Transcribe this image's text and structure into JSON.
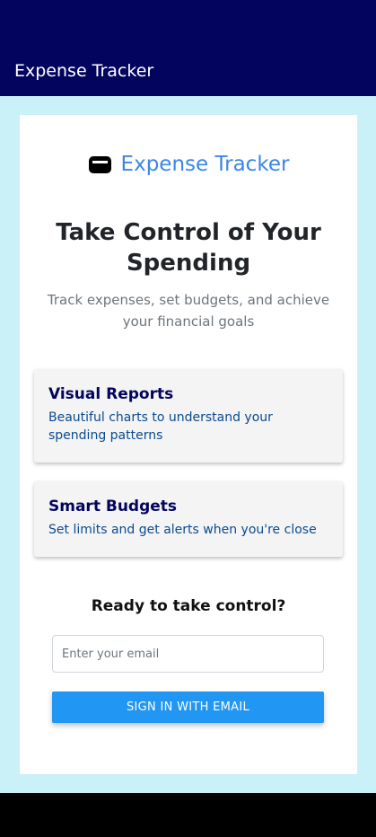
{
  "appbar": {
    "title": "Expense Tracker",
    "background_color": "#03045e"
  },
  "brand": {
    "icon": "wallet-icon",
    "name": "Expense Tracker",
    "color": "#3a86e8"
  },
  "hero": {
    "headline": "Take Control of Your Spending",
    "subhead": "Track expenses, set budgets, and achieve your financial goals"
  },
  "features": [
    {
      "title": "Visual Reports",
      "description": "Beautiful charts to understand your spending patterns"
    },
    {
      "title": "Smart Budgets",
      "description": "Set limits and get alerts when you're close"
    }
  ],
  "cta": {
    "label": "Ready to take control?",
    "email_placeholder": "Enter your email",
    "email_value": "",
    "button_label": "SIGN IN WITH EMAIL",
    "button_color": "#2196f3"
  },
  "colors": {
    "content_background": "#caf0f8",
    "feature_title": "#03045e",
    "feature_description": "#0b4a8f"
  }
}
